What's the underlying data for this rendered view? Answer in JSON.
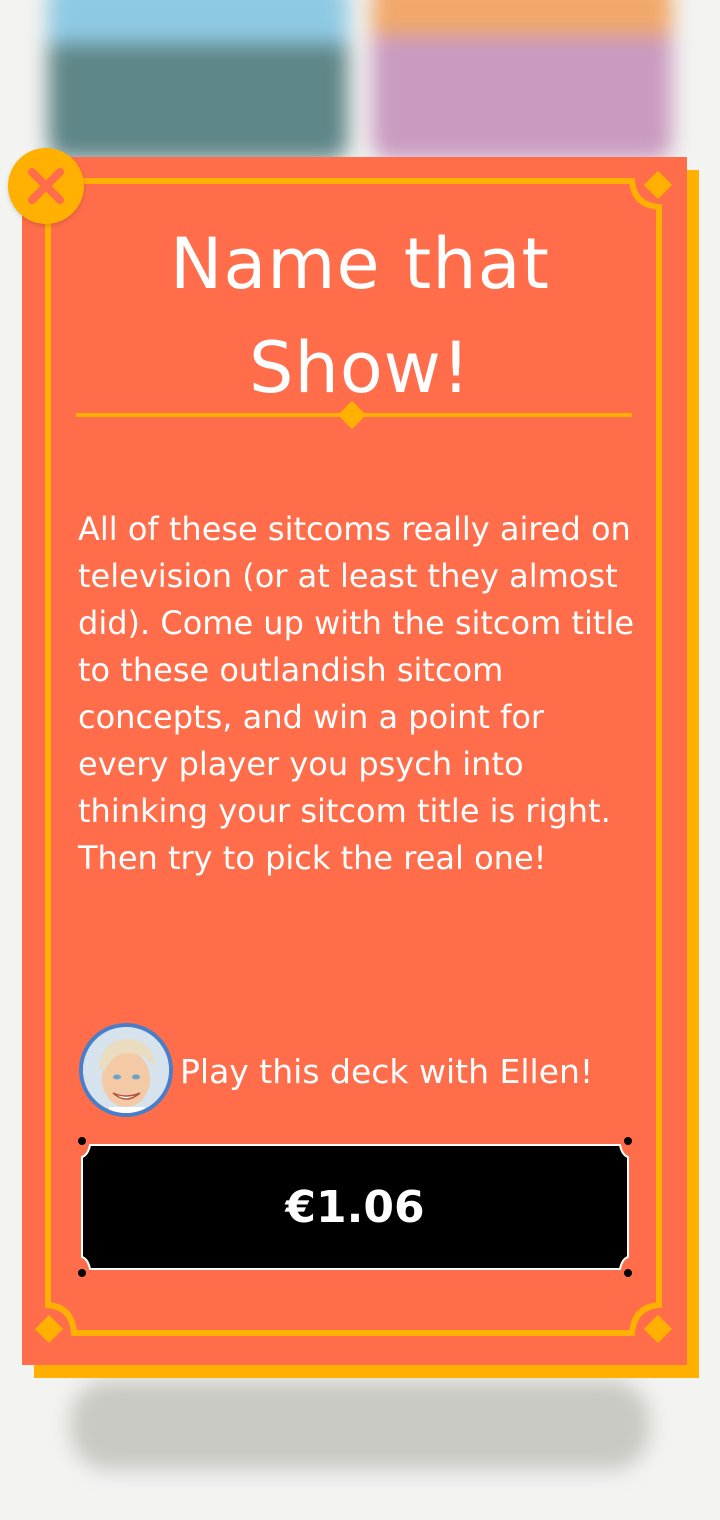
{
  "modal": {
    "title_line1": "Name that",
    "title_line2": "Show!",
    "description": "All of these sitcoms really aired on television (or at least they almost did). Come up with the sitcom title to these outlandish sitcom concepts, and win a point for every player you psych into thinking your sitcom title is right. Then try to pick the real one!",
    "play_with_label": "Play this deck with Ellen!",
    "price_label": "€1.06"
  },
  "colors": {
    "card": "#ff6d4a",
    "accent": "#ffb000",
    "button": "#000000",
    "text": "#ffffff"
  },
  "icons": {
    "close": "close-icon",
    "avatar": "ellen-avatar"
  }
}
